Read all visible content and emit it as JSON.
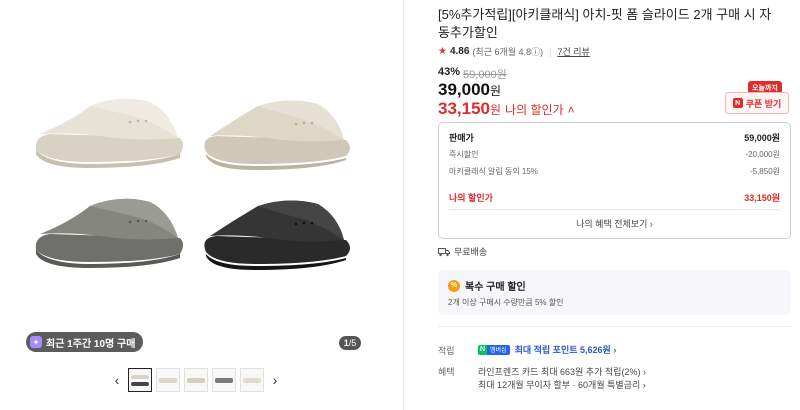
{
  "gallery": {
    "recent_badge_icon": "sparkle-icon",
    "recent_badge": "최근 1주간 10명 구매",
    "pager_current": "1",
    "pager_total": "/5",
    "prev_arrow": "‹",
    "next_arrow": "›"
  },
  "product": {
    "title": "[5%추가적립][아키클래식] 아치-핏 폼 슬라이드 2개 구매 시 자동추가할인",
    "rating_star": "★",
    "rating": "4.86",
    "rating_recent": "(최근 6개월 4.8",
    "rating_info_icon": "ⓘ",
    "rating_recent_close": ")",
    "review_count": "7건 리뷰",
    "discount_pct": "43%",
    "original_price": "59,000원",
    "price": "39,000",
    "price_unit": "원",
    "my_price": "33,150",
    "my_price_unit": "원",
    "my_price_label": "나의 할인가",
    "my_price_caret": "˄",
    "today_tag": "오늘까지",
    "coupon_n": "N",
    "coupon_label": "쿠폰 받기"
  },
  "price_box": {
    "rows": [
      {
        "label": "판매가",
        "value": "59,000원"
      },
      {
        "label": "즉시할인",
        "value": "-20,000원"
      },
      {
        "label": "아키클래식 알림 동의 15%",
        "value": "-5,850원"
      },
      {
        "label": "나의 할인가",
        "value": "33,150원"
      }
    ],
    "more_link": "나의 혜택 전체보기 ›"
  },
  "shipping": {
    "label": "무료배송",
    "icon": "truck-icon"
  },
  "promo": {
    "icon_symbol": "%",
    "title": "복수 구매 할인",
    "desc": "2개 이상 구매시 수량만큼 5% 할인"
  },
  "points": {
    "label": "적립",
    "logo_n": "N",
    "logo_text": "멤버십",
    "text": "최대 적립 포인트 5,626원 ›"
  },
  "benefits": {
    "label": "혜택",
    "line1": "라인프렌즈 카드 최대 663원 추가 적립(2%) ›",
    "line2": "최대 12개월 무이자 할부 · 60개월 특별금리 ›"
  },
  "colors": {
    "accent_red": "#e02b2b",
    "point_blue": "#2b59c3",
    "naver_green": "#03c75a"
  }
}
